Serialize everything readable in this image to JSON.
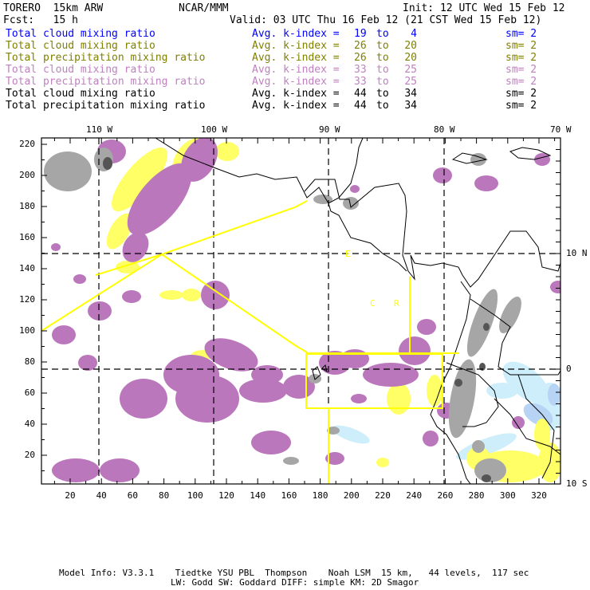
{
  "header": {
    "model": "TORERO  15km ARW",
    "center": "NCAR/MMM",
    "init": "Init: 12 UTC Wed 15 Feb 12",
    "fcst": "Fcst:   15 h",
    "valid": "Valid: 03 UTC Thu 16 Feb 12 (21 CST Wed 15 Feb 12)"
  },
  "legend": [
    {
      "label": "Total cloud mixing ratio",
      "avg": "Avg. k-index =",
      "from": "19",
      "to_word": "to",
      "to": "4",
      "sm": "sm= 2",
      "color": "#0000ff"
    },
    {
      "label": "Total cloud mixing ratio",
      "avg": "Avg. k-index =",
      "from": "26",
      "to_word": "to",
      "to": "20",
      "sm": "sm= 2",
      "color": "#808000"
    },
    {
      "label": "Total precipitation mixing ratio",
      "avg": "Avg. k-index =",
      "from": "26",
      "to_word": "to",
      "to": "20",
      "sm": "sm= 2",
      "color": "#808000"
    },
    {
      "label": "Total cloud mixing ratio",
      "avg": "Avg. k-index =",
      "from": "33",
      "to_word": "to",
      "to": "25",
      "sm": "sm= 2",
      "color": "#c080c0"
    },
    {
      "label": "Total precipitation mixing ratio",
      "avg": "Avg. k-index =",
      "from": "33",
      "to_word": "to",
      "to": "25",
      "sm": "sm= 2",
      "color": "#c080c0"
    },
    {
      "label": "Total cloud mixing ratio",
      "avg": "Avg. k-index =",
      "from": "44",
      "to_word": "to",
      "to": "34",
      "sm": "sm= 2",
      "color": "#000000"
    },
    {
      "label": "Total precipitation mixing ratio",
      "avg": "Avg. k-index =",
      "from": "44",
      "to_word": "to",
      "to": "34",
      "sm": "sm= 2",
      "color": "#000000"
    }
  ],
  "axes": {
    "x_ticks": [
      "20",
      "40",
      "60",
      "80",
      "100",
      "120",
      "140",
      "160",
      "180",
      "200",
      "220",
      "240",
      "260",
      "280",
      "300",
      "320"
    ],
    "y_ticks": [
      "20",
      "40",
      "60",
      "80",
      "100",
      "120",
      "140",
      "160",
      "180",
      "200",
      "220"
    ],
    "lon_labels": [
      "110 W",
      "100 W",
      "90 W",
      "80 W",
      "70 W"
    ],
    "lat_labels": [
      "10 N",
      "0",
      "10 S"
    ],
    "map_letters": [
      "E",
      "C",
      "R"
    ]
  },
  "footer": {
    "line1": "Model Info: V3.3.1    Tiedtke YSU PBL  Thompson    Noah LSM  15 km,   44 levels,  117 sec",
    "line2": "LW: Godd SW: Goddard DIFF: simple KM: 2D Smagor"
  },
  "colors": {
    "purple": "#bb77bb",
    "yellow": "#ffff66",
    "gray": "#a6a6a6",
    "dark_gray": "#555555",
    "light_blue": "#cdeefa",
    "blue_tint": "#b8d4f4",
    "boundary": "#ffff00"
  }
}
